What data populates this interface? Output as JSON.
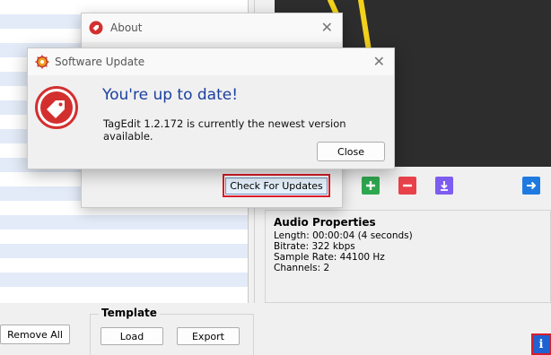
{
  "about_dialog": {
    "title": "About",
    "check_updates_label": "Check For Updates"
  },
  "update_dialog": {
    "title": "Software Update",
    "heading": "You're up to date!",
    "message": "TagEdit 1.2.172 is currently the newest version available.",
    "close_label": "Close"
  },
  "toolbar": {
    "add_icon": "plus-icon",
    "remove_icon": "minus-icon",
    "download_icon": "download-icon",
    "next_icon": "arrow-right-icon",
    "colors": {
      "add": "#2fa84f",
      "remove": "#e8414a",
      "download": "#7d5cf0",
      "next": "#1f7ae0"
    }
  },
  "audio_properties": {
    "title": "Audio Properties",
    "lines": [
      "Length: 00:00:04 (4 seconds)",
      "Bitrate: 322 kbps",
      "Sample Rate: 44100 Hz",
      "Channels: 2"
    ]
  },
  "bottom": {
    "remove_all_label": "Remove All",
    "template_label": "Template",
    "load_label": "Load",
    "export_label": "Export",
    "info_label": "i"
  }
}
